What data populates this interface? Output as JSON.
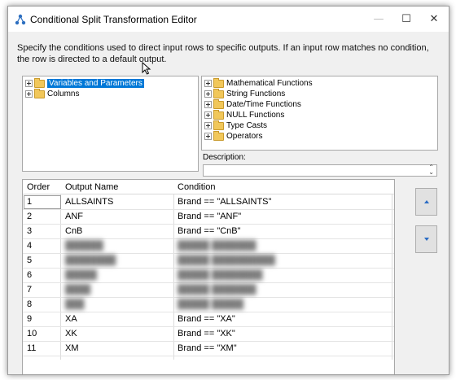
{
  "window": {
    "title": "Conditional Split Transformation Editor",
    "minimize_glyph": "—",
    "maximize_glyph": "☐",
    "close_glyph": "✕"
  },
  "instructions": "Specify the conditions used to direct input rows to specific outputs. If an input row matches no condition, the row is directed to a default output.",
  "left_tree": {
    "items": [
      {
        "label": "Variables and Parameters",
        "selected": true,
        "icon": "folder-icon"
      },
      {
        "label": "Columns",
        "selected": false,
        "icon": "folder-icon"
      }
    ]
  },
  "right_tree": {
    "items": [
      {
        "label": "Mathematical Functions",
        "icon": "folder-icon"
      },
      {
        "label": "String Functions",
        "icon": "folder-icon"
      },
      {
        "label": "Date/Time Functions",
        "icon": "folder-icon"
      },
      {
        "label": "NULL Functions",
        "icon": "folder-icon"
      },
      {
        "label": "Type Casts",
        "icon": "folder-icon"
      },
      {
        "label": "Operators",
        "icon": "folder-icon"
      }
    ]
  },
  "description": {
    "label": "Description:",
    "value": ""
  },
  "grid": {
    "headers": {
      "order": "Order",
      "output_name": "Output Name",
      "condition": "Condition"
    },
    "rows": [
      {
        "order": "1",
        "output_name": "ALLSAINTS",
        "condition": "Brand == \"ALLSAINTS\"",
        "blurred": false
      },
      {
        "order": "2",
        "output_name": "ANF",
        "condition": "Brand == \"ANF\"",
        "blurred": false
      },
      {
        "order": "3",
        "output_name": "CnB",
        "condition": "Brand == \"CnB\"",
        "blurred": false
      },
      {
        "order": "4",
        "output_name": "",
        "condition": "",
        "blurred": true
      },
      {
        "order": "5",
        "output_name": "",
        "condition": "",
        "blurred": true
      },
      {
        "order": "6",
        "output_name": "",
        "condition": "",
        "blurred": true
      },
      {
        "order": "7",
        "output_name": "",
        "condition": "",
        "blurred": true
      },
      {
        "order": "8",
        "output_name": "",
        "condition": "",
        "blurred": true
      },
      {
        "order": "9",
        "output_name": "XA",
        "condition": "Brand == \"XA\"",
        "blurred": false
      },
      {
        "order": "10",
        "output_name": "XK",
        "condition": "Brand == \"XK\"",
        "blurred": false
      },
      {
        "order": "11",
        "output_name": "XM",
        "condition": "Brand == \"XM\"",
        "blurred": false
      }
    ]
  },
  "buttons": {
    "move_up_icon": "arrow-up-icon",
    "move_down_icon": "arrow-down-icon"
  },
  "colors": {
    "selection": "#0078d7",
    "arrow": "#2a6cc4",
    "folder": "#f1c75a"
  }
}
